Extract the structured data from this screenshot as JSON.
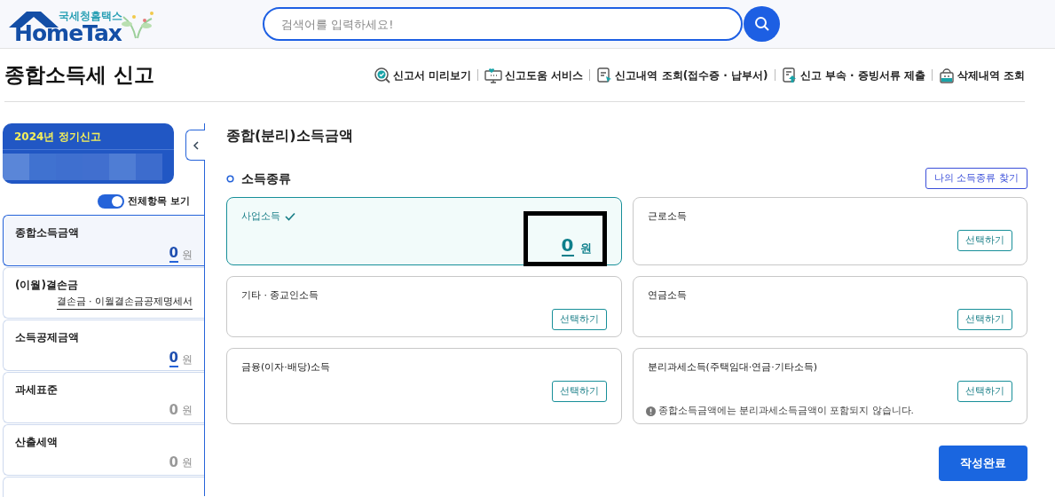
{
  "header": {
    "logo_caption": "국세청홈택스",
    "logo_word": "HomeTax",
    "search": {
      "placeholder": "검색어를 입력하세요!"
    }
  },
  "page_title": "종합소득세 신고",
  "toolbar": [
    {
      "label": "신고서 미리보기"
    },
    {
      "label": "신고도움 서비스"
    },
    {
      "label": "신고내역 조회(접수증 · 납부서)"
    },
    {
      "label": "신고 부속 · 증빙서류 제출"
    },
    {
      "label": "삭제내역 조회"
    }
  ],
  "sidebar": {
    "badge": "2024년 정기신고",
    "toggle": {
      "label": "전체항목 보기",
      "on": true
    },
    "items": [
      {
        "label": "종합소득금액",
        "kind": "amount",
        "value": "0",
        "unit": "원",
        "editable": true,
        "selected": true
      },
      {
        "label": "(이월)결손금",
        "kind": "link",
        "link": "결손금 · 이월결손금공제명세서",
        "selected": false
      },
      {
        "label": "소득공제금액",
        "kind": "amount",
        "value": "0",
        "unit": "원",
        "editable": true,
        "selected": false
      },
      {
        "label": "과세표준",
        "kind": "amount",
        "value": "0",
        "unit": "원",
        "editable": false,
        "selected": false
      },
      {
        "label": "산출세액",
        "kind": "amount",
        "value": "0",
        "unit": "원",
        "editable": false,
        "selected": false
      }
    ]
  },
  "main": {
    "heading": "종합(분리)소득금액",
    "section": "소득종류",
    "find_button": "나의 소득종류 찾기",
    "cards": [
      {
        "label": "사업소득",
        "selected": true,
        "amount": "0",
        "unit": "원"
      },
      {
        "label": "근로소득",
        "selected": false,
        "button": "선택하기"
      },
      {
        "label": "기타 · 종교인소득",
        "selected": false,
        "button": "선택하기"
      },
      {
        "label": "연금소득",
        "selected": false,
        "button": "선택하기"
      },
      {
        "label": "금융(이자·배당)소득",
        "selected": false,
        "button": "선택하기"
      },
      {
        "label": "분리과세소득(주택임대·연금·기타소득)",
        "selected": false,
        "button": "선택하기",
        "note": "종합소득금액에는 분리과세소득금액이 포함되지 않습니다."
      }
    ],
    "submit": "작성완료"
  }
}
